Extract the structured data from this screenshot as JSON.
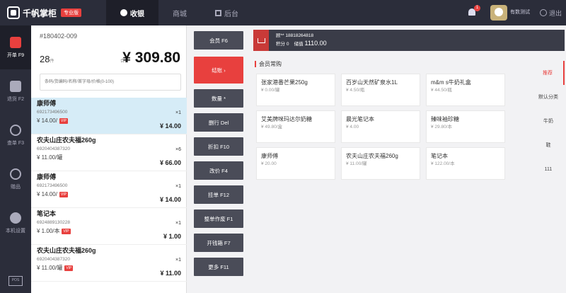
{
  "app": {
    "title": "千帆掌柜",
    "badge": "专业版"
  },
  "tabs": [
    {
      "label": "收银",
      "active": true
    },
    {
      "label": "商城",
      "active": false
    },
    {
      "label": "后台",
      "active": false
    }
  ],
  "header": {
    "notifications": "1",
    "user_name": "有数测试",
    "exit_label": "退出"
  },
  "sidebar": {
    "items": [
      {
        "label": "开单 F9",
        "icon": "receipt-icon",
        "active": true
      },
      {
        "label": "退货 F2",
        "icon": "return-icon",
        "active": false
      },
      {
        "label": "查单 F3",
        "icon": "search-icon",
        "active": false
      },
      {
        "label": "赠品",
        "icon": "gift-icon",
        "active": false
      },
      {
        "label": "本机设置",
        "icon": "gear-icon",
        "active": false
      }
    ],
    "pos_label": "POS"
  },
  "cart": {
    "order_no": "#180402-009",
    "qty": "28",
    "qty_unit": "件",
    "total_label": "合计",
    "total": "¥ 309.80",
    "search_placeholder": "条码/货编码/名称/首字母/价格(0-100)",
    "items": [
      {
        "name": "康师傅",
        "code": "692173496500",
        "price": "¥ 14.00/",
        "count": "×1",
        "subtotal": "¥ 14.00",
        "selected": true
      },
      {
        "name": "农夫山庄农夫福260g",
        "code": "6920404387320",
        "price": "¥ 11.00/罐",
        "count": "×6",
        "subtotal": "¥ 66.00",
        "selected": false
      },
      {
        "name": "康师傅",
        "code": "692173496500",
        "price": "¥ 14.00/",
        "count": "×1",
        "subtotal": "¥ 14.00",
        "selected": false
      },
      {
        "name": "笔记本",
        "code": "6924889130228",
        "price": "¥ 1.00/本",
        "count": "×1",
        "subtotal": "¥ 1.00",
        "selected": false
      },
      {
        "name": "农夫山庄农夫福260g",
        "code": "6920404387320",
        "price": "¥ 11.00/罐",
        "count": "×1",
        "subtotal": "¥ 11.00",
        "selected": false
      }
    ],
    "vip_label": "VIP"
  },
  "actions": [
    {
      "label": "会员 F6",
      "type": "first"
    },
    {
      "label": "结账 ›",
      "type": "big"
    },
    {
      "label": "数量 *",
      "type": "normal"
    },
    {
      "label": "删行 Del",
      "type": "normal"
    },
    {
      "label": "折扣 F10",
      "type": "normal"
    },
    {
      "label": "改价 F4",
      "type": "normal"
    },
    {
      "label": "挂单 F12",
      "type": "normal"
    },
    {
      "label": "整单作废 F1",
      "type": "normal"
    },
    {
      "label": "开钱箱 F7",
      "type": "normal"
    },
    {
      "label": "更多 F11",
      "type": "normal"
    }
  ],
  "member": {
    "phone": "顾** 18818264818",
    "points_label": "积分",
    "points": "0",
    "balance_label": "储值",
    "balance": "1110.00"
  },
  "frequent": {
    "title": "会员常购",
    "products": [
      {
        "name": "张家港番芒果250g",
        "price": "¥ 0.00/罐"
      },
      {
        "name": "百岁山天然矿泉水1L",
        "price": "¥ 4.50/瓶"
      },
      {
        "name": "m&m s牛奶礼盒",
        "price": "¥ 44.50/瓶"
      },
      {
        "name": "艾美牌咪玛达尔奶糖",
        "price": "¥ 49.80/盒"
      },
      {
        "name": "晨光笔记本",
        "price": "¥ 4.00"
      },
      {
        "name": "臻味袖珍糖",
        "price": "¥ 29.80/本"
      },
      {
        "name": "康师傅",
        "price": "¥ 20.00"
      },
      {
        "name": "农夫山庄农夫福260g",
        "price": "¥ 11.00/罐"
      },
      {
        "name": "笔记本",
        "price": "¥ 122.00/本"
      }
    ]
  },
  "categories": [
    {
      "label": "推荐",
      "active": true
    },
    {
      "label": "默认分类",
      "active": false
    },
    {
      "label": "牛奶",
      "active": false
    },
    {
      "label": "鞋",
      "active": false
    },
    {
      "label": "111",
      "active": false
    }
  ]
}
